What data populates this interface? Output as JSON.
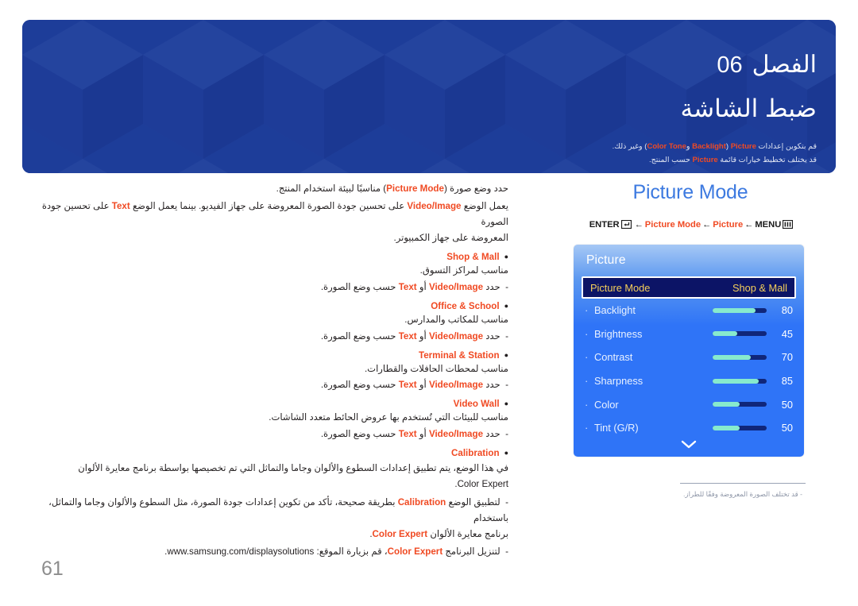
{
  "header": {
    "chapter_label": "الفصل",
    "chapter_number": "06",
    "title": "ضبط الشاشة",
    "note_line1_pre": "قم بتكوين إعدادات ",
    "note_line1_t1": "Picture",
    "note_line1_mid1": " (",
    "note_line1_t2": "Backlight",
    "note_line1_mid2": " و",
    "note_line1_t3": "Color Tone",
    "note_line1_post": ") وغير ذلك.",
    "note_line2_pre": "قد يختلف تخطيط خيارات قائمة ",
    "note_line2_t1": "Picture",
    "note_line2_post": " حسب المنتج."
  },
  "section": {
    "title": "Picture Mode",
    "nav": {
      "enter": "ENTER",
      "enter_glyph": "enter-key-icon",
      "arrow": "←",
      "step1": "Picture Mode",
      "step2": "Picture",
      "menu": "MENU",
      "menu_glyph": "menu-key-icon"
    }
  },
  "tv_menu": {
    "heading": "Picture",
    "selected_row": {
      "label": "Picture Mode",
      "value": "Shop & Mall"
    },
    "rows": [
      {
        "label": "Backlight",
        "value": "80",
        "percent": 80
      },
      {
        "label": "Brightness",
        "value": "45",
        "percent": 45
      },
      {
        "label": "Contrast",
        "value": "70",
        "percent": 70
      },
      {
        "label": "Sharpness",
        "value": "85",
        "percent": 85
      },
      {
        "label": "Color",
        "value": "50",
        "percent": 50
      },
      {
        "label": "Tint (G/R)",
        "value": "50",
        "percent": 50
      }
    ],
    "scroll_down_icon": "chevron-down-icon"
  },
  "footnote": {
    "text": "-  قد تختلف الصورة المعروضة وفقًا للطراز."
  },
  "body": {
    "intro1_a": "حدد وضع صورة (",
    "intro1_term": "Picture Mode",
    "intro1_b": ") مناسبًا لبيئة استخدام المنتج.",
    "intro2_a": "يعمل الوضع ",
    "intro2_t1": "Video/Image",
    "intro2_b": " على تحسين جودة الصورة المعروضة على جهاز الفيديو. بينما يعمل الوضع ",
    "intro2_t2": "Text",
    "intro2_c": " على تحسين جودة الصورة",
    "intro2_d": "المعروضة على جهاز الكمبيوتر.",
    "select_prefix": "حدد ",
    "select_t1": "Video/Image",
    "select_or": " أو ",
    "select_t2": "Text",
    "select_suffix": " حسب وضع الصورة.",
    "dash": "-",
    "modes": [
      {
        "name": "Shop & Mall",
        "desc": "مناسب لمراكز التسوق."
      },
      {
        "name": "Office & School",
        "desc": "مناسب للمكاتب والمدارس."
      },
      {
        "name": "Terminal & Station",
        "desc": "مناسب لمحطات الحافلات والقطارات."
      },
      {
        "name": "Video Wall",
        "desc": "مناسب للبيئات التي تُستخدم بها عروض الحائط متعدد الشاشات."
      }
    ],
    "calibration": {
      "name": "Calibration",
      "desc_line1": "في هذا الوضع، يتم تطبيق إعدادات السطوع والألوان وجاما والتماثل التي تم تخصيصها بواسطة برنامج معايرة الألوان",
      "desc_line2": "Color Expert."
    },
    "cal_note1_a": "لتطبيق الوضع ",
    "cal_note1_term": "Calibration",
    "cal_note1_b": " بطريقة صحيحة، تأكد من تكوين إعدادات جودة الصورة، مثل السطوع والألوان وجاما والتماثل، باستخدام",
    "cal_note1_c": "برنامج معايرة الألوان ",
    "cal_note1_term2": "Color Expert",
    "cal_note1_d": ".",
    "cal_note2_a": "لتنزيل البرنامج ",
    "cal_note2_term": "Color Expert",
    "cal_note2_b": "، قم بزيارة الموقع: ",
    "cal_note2_url": "www.samsung.com/displaysolutions",
    "cal_note2_c": "."
  },
  "page_number": "61",
  "colors": {
    "banner_blue": "#1e3d99",
    "accent_orange": "#f04a23",
    "section_blue": "#3d7ae0",
    "tv_blue": "#2f74f7",
    "tv_selected_bg": "#0c1466",
    "tv_selected_text": "#f5cf5a",
    "slider_fill": "#87eacd",
    "slider_track": "#10267a"
  }
}
